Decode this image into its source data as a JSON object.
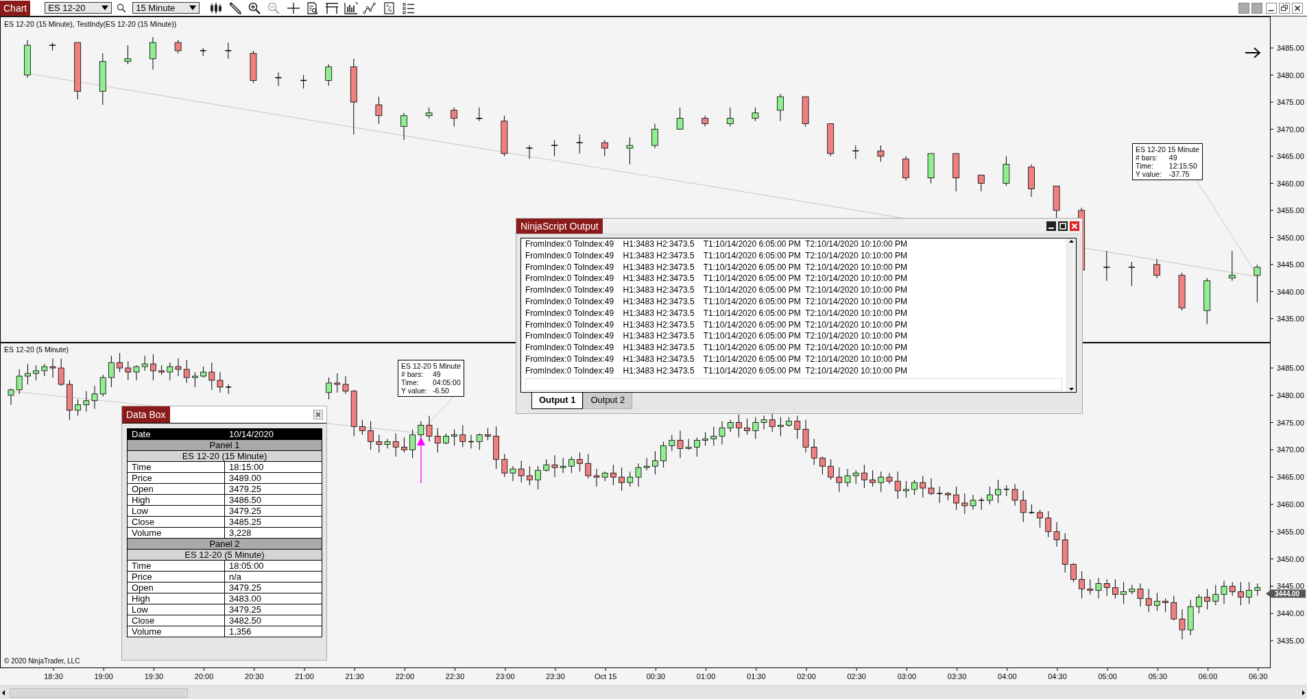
{
  "toolbar": {
    "title": "Chart",
    "instrument": "ES 12-20",
    "interval": "15 Minute"
  },
  "panels": [
    {
      "title": "ES 12-20 (15 Minute), TestIndy(ES 12-20 (15 Minute))",
      "price_labels": [
        "3485.00",
        "3480.00",
        "3475.00",
        "3470.00",
        "3465.00",
        "3460.00",
        "3455.00",
        "3450.00",
        "3445.00",
        "3440.00",
        "3435.00"
      ]
    },
    {
      "title": "ES 12-20 (5 Minute)",
      "price_labels": [
        "3485.00",
        "3480.00",
        "3475.00",
        "3470.00",
        "3465.00",
        "3460.00",
        "3455.00",
        "3450.00",
        "3445.00",
        "3440.00",
        "3435.00"
      ],
      "price_marker": "3444.00",
      "copyright": "© 2020 NinjaTrader, LLC"
    }
  ],
  "x_axis": [
    "18:30",
    "19:00",
    "19:30",
    "20:00",
    "20:30",
    "21:00",
    "21:30",
    "22:00",
    "22:30",
    "23:00",
    "23:30",
    "Oct 15",
    "00:30",
    "01:00",
    "01:30",
    "02:00",
    "02:30",
    "03:00",
    "03:30",
    "04:00",
    "04:30",
    "05:00",
    "05:30",
    "06:00",
    "06:30"
  ],
  "tooltips": [
    {
      "title": "ES 12-20 15 Minute",
      "rows": [
        {
          "label": "# bars:",
          "value": "49"
        },
        {
          "label": "Time:",
          "value": "12:15:50"
        },
        {
          "label": "Y value:",
          "value": "-37.75"
        }
      ]
    },
    {
      "title": "ES 12-20 5 Minute",
      "rows": [
        {
          "label": "# bars:",
          "value": "49"
        },
        {
          "label": "Time:",
          "value": "04:05:00"
        },
        {
          "label": "Y value:",
          "value": "-6.50"
        }
      ]
    }
  ],
  "output_window": {
    "title": "NinjaScript Output",
    "lines": [
      "FromIndex:0 ToIndex:49    H1:3483 H2:3473.5    T1:10/14/2020 6:05:00 PM  T2:10/14/2020 10:10:00 PM",
      "FromIndex:0 ToIndex:49    H1:3483 H2:3473.5    T1:10/14/2020 6:05:00 PM  T2:10/14/2020 10:10:00 PM",
      "FromIndex:0 ToIndex:49    H1:3483 H2:3473.5    T1:10/14/2020 6:05:00 PM  T2:10/14/2020 10:10:00 PM",
      "FromIndex:0 ToIndex:49    H1:3483 H2:3473.5    T1:10/14/2020 6:05:00 PM  T2:10/14/2020 10:10:00 PM",
      "FromIndex:0 ToIndex:49    H1:3483 H2:3473.5    T1:10/14/2020 6:05:00 PM  T2:10/14/2020 10:10:00 PM",
      "FromIndex:0 ToIndex:49    H1:3483 H2:3473.5    T1:10/14/2020 6:05:00 PM  T2:10/14/2020 10:10:00 PM",
      "FromIndex:0 ToIndex:49    H1:3483 H2:3473.5    T1:10/14/2020 6:05:00 PM  T2:10/14/2020 10:10:00 PM",
      "FromIndex:0 ToIndex:49    H1:3483 H2:3473.5    T1:10/14/2020 6:05:00 PM  T2:10/14/2020 10:10:00 PM",
      "FromIndex:0 ToIndex:49    H1:3483 H2:3473.5    T1:10/14/2020 6:05:00 PM  T2:10/14/2020 10:10:00 PM",
      "FromIndex:0 ToIndex:49    H1:3483 H2:3473.5    T1:10/14/2020 6:05:00 PM  T2:10/14/2020 10:10:00 PM",
      "FromIndex:0 ToIndex:49    H1:3483 H2:3473.5    T1:10/14/2020 6:05:00 PM  T2:10/14/2020 10:10:00 PM",
      "FromIndex:0 ToIndex:49    H1:3483 H2:3473.5    T1:10/14/2020 6:05:00 PM  T2:10/14/2020 10:10:00 PM"
    ],
    "tabs": [
      {
        "label": "Output 1",
        "selected": true
      },
      {
        "label": "Output 2",
        "selected": false
      }
    ]
  },
  "data_box": {
    "title": "Data Box",
    "date_label": "Date",
    "date": "10/14/2020",
    "panels": [
      {
        "title": "Panel 1",
        "series": "ES 12-20 (15 Minute)",
        "rows": [
          {
            "label": "Time",
            "value": "18:15:00"
          },
          {
            "label": "Price",
            "value": "3489.00"
          },
          {
            "label": "Open",
            "value": "3479.25"
          },
          {
            "label": "High",
            "value": "3486.50"
          },
          {
            "label": "Low",
            "value": "3479.25"
          },
          {
            "label": "Close",
            "value": "3485.25"
          },
          {
            "label": "Volume",
            "value": "3,228"
          }
        ]
      },
      {
        "title": "Panel 2",
        "series": "ES 12-20 (5 Minute)",
        "rows": [
          {
            "label": "Time",
            "value": "18:05:00"
          },
          {
            "label": "Price",
            "value": "n/a"
          },
          {
            "label": "Open",
            "value": "3479.25"
          },
          {
            "label": "High",
            "value": "3483.00"
          },
          {
            "label": "Low",
            "value": "3479.25"
          },
          {
            "label": "Close",
            "value": "3482.50"
          },
          {
            "label": "Volume",
            "value": "1,356"
          }
        ]
      }
    ]
  }
}
